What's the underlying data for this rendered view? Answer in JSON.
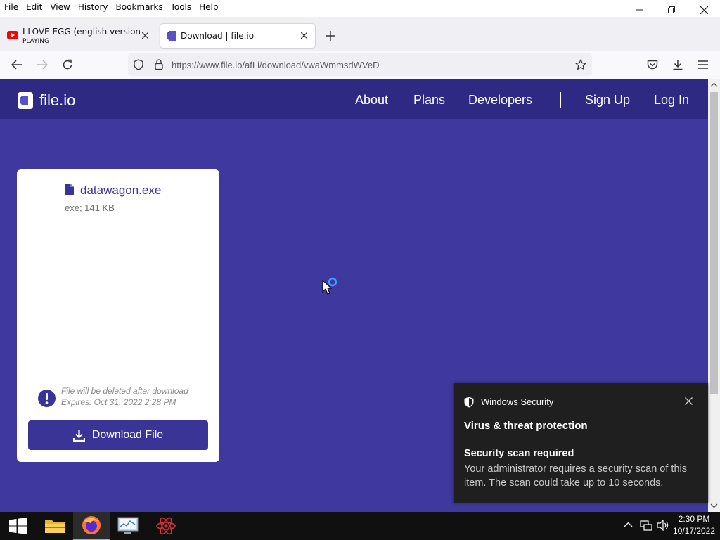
{
  "menubar": {
    "items": [
      "File",
      "Edit",
      "View",
      "History",
      "Bookmarks",
      "Tools",
      "Help"
    ]
  },
  "tabs": [
    {
      "title": "I LOVE EGG (english version) - Y",
      "status": "PLAYING",
      "icon": "youtube-icon"
    },
    {
      "title": "Download | file.io",
      "icon": "file-io-icon"
    }
  ],
  "address_bar": {
    "url": "https://www.file.io/afLi/download/vwaWmmsdWVeD"
  },
  "site": {
    "logo_text": "file.io",
    "nav": [
      "About",
      "Plans",
      "Developers",
      "Sign Up",
      "Log In"
    ]
  },
  "file_card": {
    "file_name": "datawagon.exe",
    "file_meta": "exe; 141 KB",
    "notice_line1": "File will be deleted after download",
    "notice_line2": "Expires: Oct 31, 2022 2:28 PM",
    "download_label": "Download File"
  },
  "toast": {
    "app": "Windows Security",
    "title": "Virus & threat protection",
    "heading": "Security scan required",
    "body": "Your administrator requires a security scan of this item. The scan could take up to 10 seconds."
  },
  "taskbar": {
    "time": "2:30 PM",
    "date": "10/17/2022"
  },
  "colors": {
    "brand_dark": "#2e2a84",
    "brand": "#3f399f",
    "button": "#3a3496",
    "toast_bg": "#1f1f1f"
  }
}
